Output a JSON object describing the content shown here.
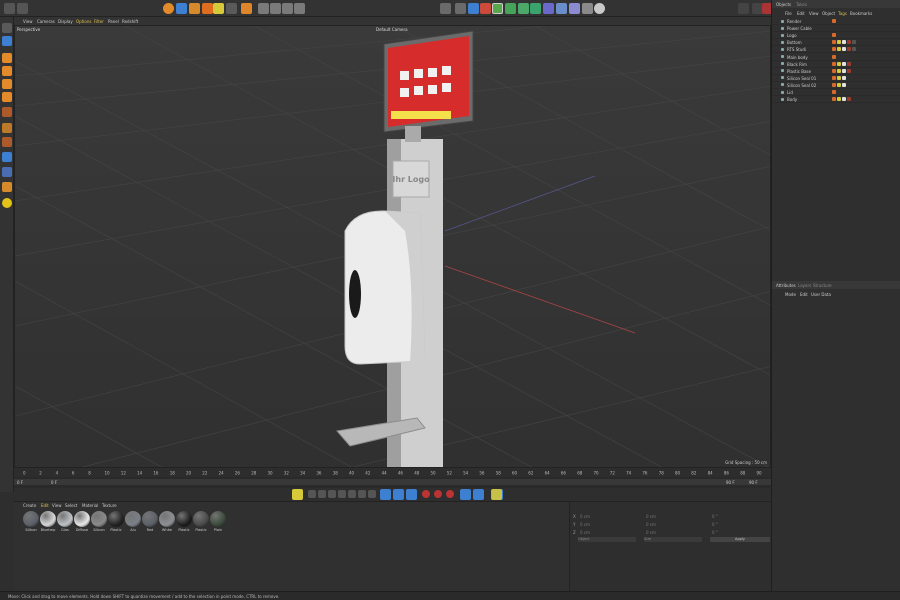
{
  "viewport": {
    "menu": [
      "View",
      "Cameras",
      "Display",
      "Options",
      "Filter",
      "Panel",
      "Redshift"
    ],
    "label": "Perspective",
    "camera": "Default Camera",
    "grid_spacing": "Grid Spacing : 50 cm"
  },
  "screen": {
    "title": "Ihr Logo"
  },
  "timeline": {
    "ruler": [
      "0",
      "2",
      "4",
      "6",
      "8",
      "10",
      "12",
      "14",
      "16",
      "18",
      "20",
      "22",
      "24",
      "26",
      "28",
      "30",
      "32",
      "34",
      "36",
      "38",
      "40",
      "42",
      "44",
      "46",
      "48",
      "50",
      "52",
      "54",
      "56",
      "58",
      "60",
      "62",
      "64",
      "66",
      "68",
      "70",
      "72",
      "74",
      "76",
      "78",
      "80",
      "82",
      "84",
      "86",
      "88",
      "90"
    ],
    "current_frame": "0 F",
    "start": "0 F",
    "end": "90 F",
    "preview_end": "90 F"
  },
  "materials": {
    "menu": [
      "Create",
      "Edit",
      "View",
      "Select",
      "Material",
      "Texture"
    ],
    "items": [
      "Silikon",
      "Bluetmp",
      "Glas",
      "Diffuse",
      "Silicon",
      "Plastic",
      "Alu",
      "Red",
      "White",
      "Plastic",
      "Plastic",
      "Plain"
    ]
  },
  "coordinates": {
    "position": [
      "0 cm",
      "0 cm",
      "0 cm"
    ],
    "size": [
      "0 cm",
      "0 cm",
      "0 cm"
    ],
    "rotation": [
      "0 °",
      "0 °",
      "0 °"
    ],
    "mode": "Object",
    "size_mode": "Size",
    "apply": "Apply"
  },
  "objects_panel": {
    "tabs": [
      "Objects",
      "Takes"
    ],
    "menu": [
      "File",
      "Edit",
      "View",
      "Object",
      "Tags",
      "Bookmarks"
    ],
    "rows": [
      "Render",
      "Power Cable",
      "Logo",
      "Bottom",
      "RTS Studi",
      "Main body",
      "Black Rim",
      "Plastic Base",
      "Silicon Seal 01",
      "Silicon Seal 02",
      "Lid",
      "Body"
    ]
  },
  "attributes_panel": {
    "tabs": [
      "Attributes",
      "Layers",
      "Structure"
    ],
    "menu": [
      "Mode",
      "Edit",
      "User Data"
    ]
  },
  "status": "Move: Click and drag to move elements. Hold down SHIFT to quantize movement / add to the selection in point mode, CTRL to remove."
}
